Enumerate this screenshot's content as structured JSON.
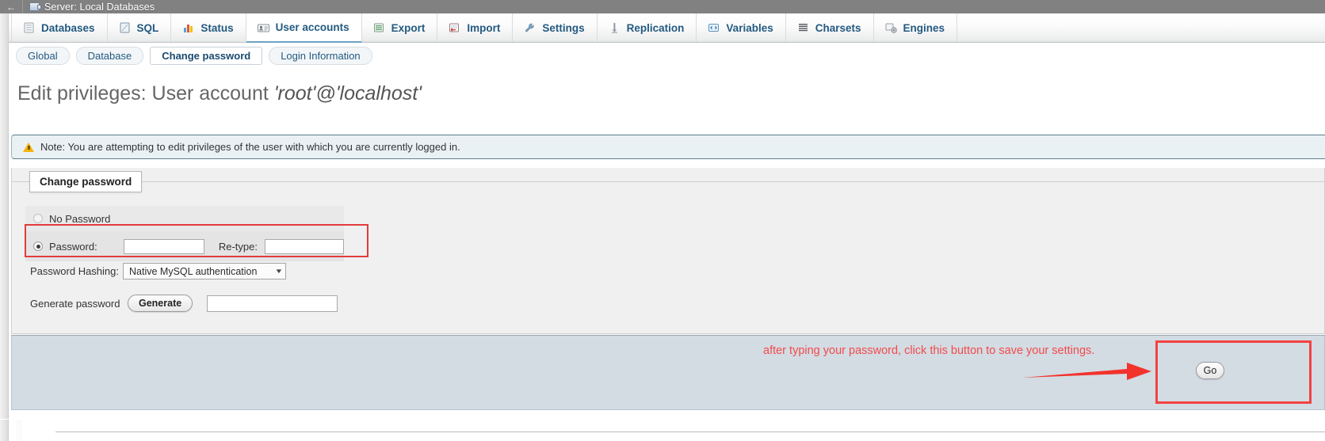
{
  "window": {
    "back_icon": "back-arrow-icon",
    "app_icon": "server-icon",
    "title": "Server: Local Databases"
  },
  "tabs": [
    {
      "label": "Databases",
      "icon": "database-icon",
      "active": false
    },
    {
      "label": "SQL",
      "icon": "sql-icon",
      "active": false
    },
    {
      "label": "Status",
      "icon": "status-chart-icon",
      "active": false
    },
    {
      "label": "User accounts",
      "icon": "user-card-icon",
      "active": true
    },
    {
      "label": "Export",
      "icon": "export-icon",
      "active": false
    },
    {
      "label": "Import",
      "icon": "import-icon",
      "active": false
    },
    {
      "label": "Settings",
      "icon": "wrench-icon",
      "active": false
    },
    {
      "label": "Replication",
      "icon": "replication-icon",
      "active": false
    },
    {
      "label": "Variables",
      "icon": "variables-icon",
      "active": false
    },
    {
      "label": "Charsets",
      "icon": "charsets-icon",
      "active": false
    },
    {
      "label": "Engines",
      "icon": "engines-icon",
      "active": false
    }
  ],
  "subtabs": [
    {
      "label": "Global",
      "active": false
    },
    {
      "label": "Database",
      "active": false
    },
    {
      "label": "Change password",
      "active": true
    },
    {
      "label": "Login Information",
      "active": false
    }
  ],
  "page": {
    "heading_prefix": "Edit privileges: User account ",
    "heading_account": "'root'@'localhost'"
  },
  "note": {
    "icon": "warning-triangle-icon",
    "text": "Note: You are attempting to edit privileges of the user with which you are currently logged in."
  },
  "form": {
    "legend": "Change password",
    "no_password_label": "No Password",
    "no_password_checked": false,
    "password_label": "Password:",
    "password_checked": true,
    "password_value": "",
    "retype_label": "Re-type:",
    "retype_value": "",
    "hashing_label": "Password Hashing:",
    "hashing_value": "Native MySQL authentication",
    "hashing_caret": "chevron-down-icon",
    "generate_label": "Generate password",
    "generate_button": "Generate",
    "generated_value": ""
  },
  "footer": {
    "go_label": "Go"
  },
  "annotation": {
    "text": "after typing your password, click this button to save your settings.",
    "arrow_icon": "right-arrow-icon",
    "color": "#f24b4b",
    "highlight_color": "#e23b3b"
  }
}
